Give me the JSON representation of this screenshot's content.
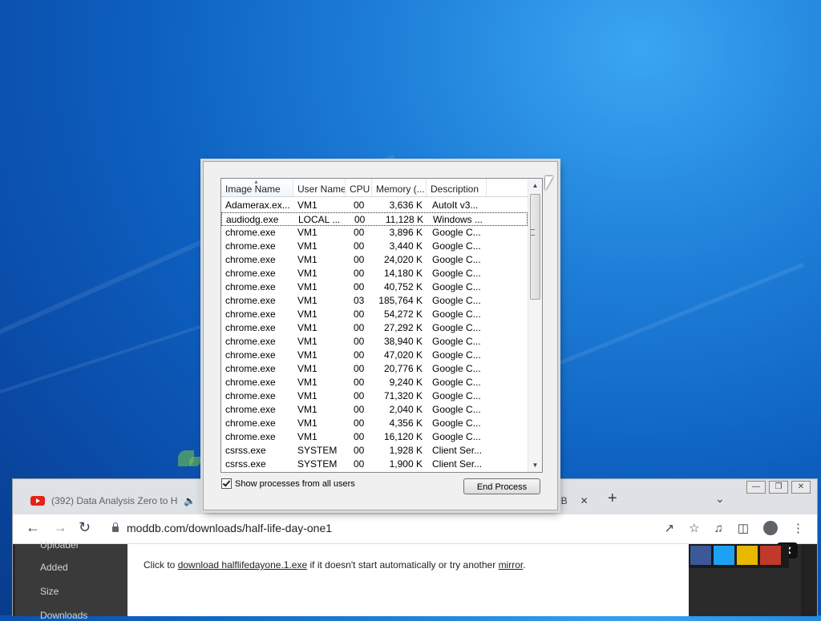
{
  "taskmanager": {
    "columns": [
      "Image Name",
      "User Name",
      "CPU",
      "Memory (...",
      "Description"
    ],
    "processes": [
      {
        "name": "Adamerax.ex...",
        "user": "VM1",
        "cpu": "00",
        "mem": "3,636 K",
        "desc": "AutoIt v3..."
      },
      {
        "name": "audiodg.exe",
        "user": "LOCAL ...",
        "cpu": "00",
        "mem": "11,128 K",
        "desc": "Windows ..."
      },
      {
        "name": "chrome.exe",
        "user": "VM1",
        "cpu": "00",
        "mem": "3,896 K",
        "desc": "Google C..."
      },
      {
        "name": "chrome.exe",
        "user": "VM1",
        "cpu": "00",
        "mem": "3,440 K",
        "desc": "Google C..."
      },
      {
        "name": "chrome.exe",
        "user": "VM1",
        "cpu": "00",
        "mem": "24,020 K",
        "desc": "Google C..."
      },
      {
        "name": "chrome.exe",
        "user": "VM1",
        "cpu": "00",
        "mem": "14,180 K",
        "desc": "Google C..."
      },
      {
        "name": "chrome.exe",
        "user": "VM1",
        "cpu": "00",
        "mem": "40,752 K",
        "desc": "Google C..."
      },
      {
        "name": "chrome.exe",
        "user": "VM1",
        "cpu": "03",
        "mem": "185,764 K",
        "desc": "Google C..."
      },
      {
        "name": "chrome.exe",
        "user": "VM1",
        "cpu": "00",
        "mem": "54,272 K",
        "desc": "Google C..."
      },
      {
        "name": "chrome.exe",
        "user": "VM1",
        "cpu": "00",
        "mem": "27,292 K",
        "desc": "Google C..."
      },
      {
        "name": "chrome.exe",
        "user": "VM1",
        "cpu": "00",
        "mem": "38,940 K",
        "desc": "Google C..."
      },
      {
        "name": "chrome.exe",
        "user": "VM1",
        "cpu": "00",
        "mem": "47,020 K",
        "desc": "Google C..."
      },
      {
        "name": "chrome.exe",
        "user": "VM1",
        "cpu": "00",
        "mem": "20,776 K",
        "desc": "Google C..."
      },
      {
        "name": "chrome.exe",
        "user": "VM1",
        "cpu": "00",
        "mem": "9,240 K",
        "desc": "Google C..."
      },
      {
        "name": "chrome.exe",
        "user": "VM1",
        "cpu": "00",
        "mem": "71,320 K",
        "desc": "Google C..."
      },
      {
        "name": "chrome.exe",
        "user": "VM1",
        "cpu": "00",
        "mem": "2,040 K",
        "desc": "Google C..."
      },
      {
        "name": "chrome.exe",
        "user": "VM1",
        "cpu": "00",
        "mem": "4,356 K",
        "desc": "Google C..."
      },
      {
        "name": "chrome.exe",
        "user": "VM1",
        "cpu": "00",
        "mem": "16,120 K",
        "desc": "Google C..."
      },
      {
        "name": "csrss.exe",
        "user": "SYSTEM",
        "cpu": "00",
        "mem": "1,928 K",
        "desc": "Client Ser..."
      },
      {
        "name": "csrss.exe",
        "user": "SYSTEM",
        "cpu": "00",
        "mem": "1,900 K",
        "desc": "Client Ser..."
      }
    ],
    "selected_index": 1,
    "show_all_label": "Show processes from all users",
    "show_all_checked": true,
    "end_process_label": "End Process"
  },
  "browser": {
    "tab1_title": "(392) Data Analysis Zero to H",
    "tab2_fragment": "DB",
    "url": "moddb.com/downloads/half-life-day-one1",
    "sidebar_items": [
      "Uploader",
      "Added",
      "Size",
      "Downloads"
    ],
    "download": {
      "prefix": "Click to ",
      "link": "download halflifedayone.1.exe",
      "middle": " if it doesn't start automatically or try another ",
      "mirror": "mirror",
      "suffix": "."
    }
  },
  "colors": {
    "desktop": "#1e7fd8",
    "selection_border": "#333333",
    "youtube_red": "#e62117"
  }
}
